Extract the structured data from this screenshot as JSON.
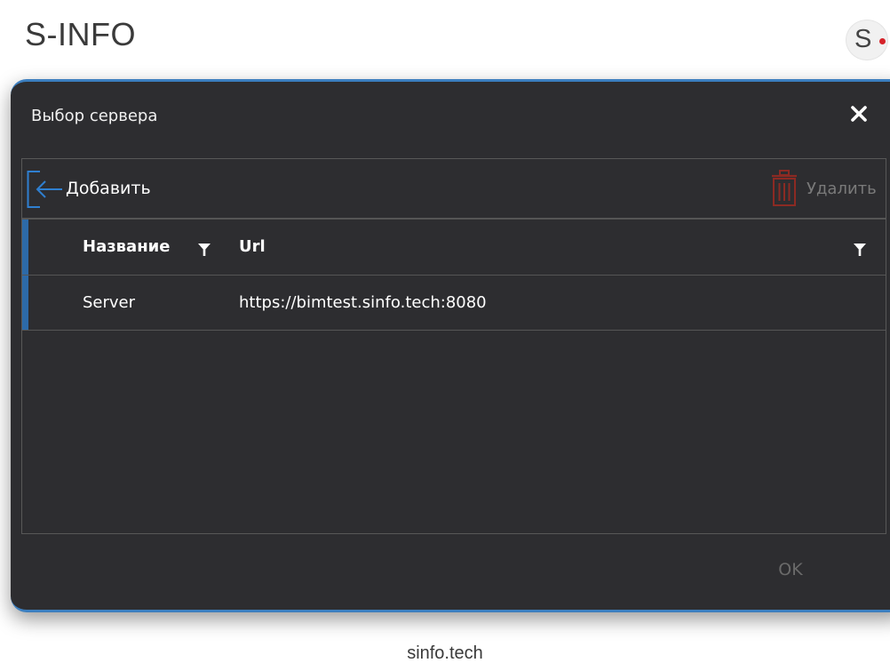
{
  "page": {
    "app_title": "S-INFO",
    "logo_letter": "S",
    "footer": "sinfo.tech"
  },
  "dialog": {
    "title": "Выбор сервера",
    "toolbar": {
      "add_label": "Добавить",
      "delete_label": "Удалить"
    },
    "grid": {
      "columns": [
        {
          "label": "Название"
        },
        {
          "label": "Url"
        }
      ],
      "rows": [
        {
          "name": "Server",
          "url": "https://bimtest.sinfo.tech:8080"
        }
      ]
    },
    "ok_label": "OK"
  },
  "icons": {
    "add": "login-arrow-icon",
    "delete": "trash-icon",
    "close": "close-icon",
    "filter": "filter-icon"
  },
  "colors": {
    "dialog_bg": "#2d2d30",
    "accent": "#3c7fc0",
    "delete_icon": "#8c2a23",
    "logo_dot": "#d6232a"
  }
}
